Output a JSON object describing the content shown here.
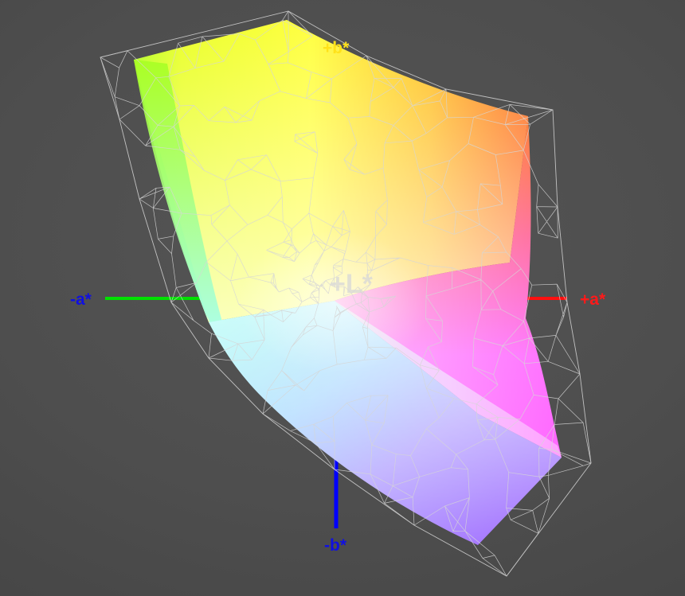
{
  "axes": {
    "neg_a": {
      "label": "-a*",
      "color": "#1010e0",
      "line_color": "#00e000"
    },
    "pos_a": {
      "label": "+a*",
      "color": "#ff1a1a",
      "line_color": "#ff1010"
    },
    "pos_b": {
      "label": "+b*",
      "color": "#ffe21a"
    },
    "neg_b": {
      "label": "-b*",
      "color": "#1010e0",
      "line_color": "#0000ff"
    },
    "pos_L": {
      "label": "+L*",
      "color": "#d8d8d8"
    }
  },
  "colors": {
    "background": "#4f4f4f",
    "wireframe": "#d6d6d6",
    "gamut_yellow": "#ffff2a",
    "gamut_orange": "#ff7a1a",
    "gamut_green": "#9cff2a",
    "gamut_cyan": "#9affee",
    "gamut_white": "#f4f4ff",
    "gamut_magenta": "#ff66ff",
    "gamut_violet": "#a46bff"
  }
}
